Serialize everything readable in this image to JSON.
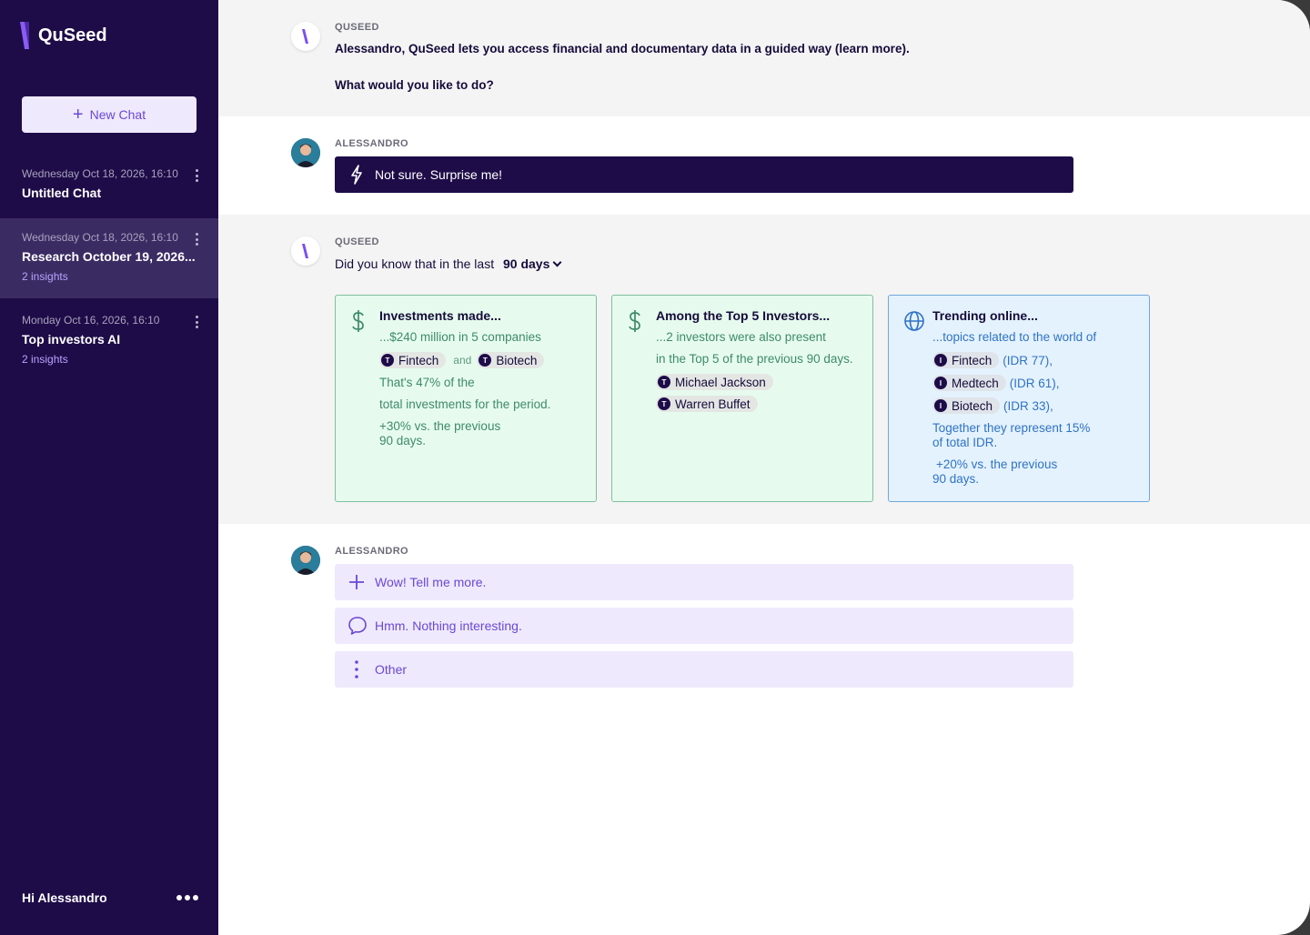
{
  "sidebar": {
    "brand": "QuSeed",
    "new_chat_label": "New Chat",
    "chats": [
      {
        "date": "Wednesday Oct 18, 2026, 16:10",
        "title": "Untitled Chat",
        "insights": ""
      },
      {
        "date": "Wednesday Oct 18, 2026, 16:10",
        "title": "Research October 19, 2026...",
        "insights": "2 insights"
      },
      {
        "date": "Monday Oct 16, 2026, 16:10",
        "title": "Top investors AI",
        "insights": "2 insights"
      }
    ],
    "greeting": "Hi Alessandro"
  },
  "conversation": {
    "intro": {
      "sender": "QUSEED",
      "line1": "Alessandro, QuSeed lets you access financial and documentary data in a guided way (learn more).",
      "line2": "What would you like to do?"
    },
    "reply1": {
      "sender": "ALESSANDRO",
      "choice": "Not sure. Surprise me!"
    },
    "insight": {
      "sender": "QUSEED",
      "prompt": "Did you know that in the last",
      "period": "90 days",
      "cards": [
        {
          "icon": "dollar-icon",
          "title": "Investments made...",
          "line1": "...$240 million in 5 companies",
          "tag1": "Fintech",
          "and": "and",
          "tag2": "Biotech",
          "line2": "That's 47% of the",
          "line3": "total investments for the period.",
          "line4a": "+30% vs. the previous",
          "line4b": "90 days."
        },
        {
          "icon": "dollar-icon",
          "title": "Among the Top 5 Investors...",
          "line1": "...2 investors were also present",
          "line2": "in the Top 5 of the previous 90 days.",
          "tag1": "Michael Jackson",
          "tag2": "Warren Buffet"
        },
        {
          "icon": "globe-icon",
          "title": "Trending online...",
          "line1": "...topics related to the world of",
          "topics": [
            {
              "tag": "Fintech",
              "idr": "(IDR 77),"
            },
            {
              "tag": "Medtech",
              "idr": "(IDR 61),"
            },
            {
              "tag": "Biotech",
              "idr": "(IDR 33),"
            }
          ],
          "line2a": "Together they represent 15%",
          "line2b": "of total IDR.",
          "line3a": "+20% vs. the previous",
          "line3b": "90 days."
        }
      ]
    },
    "reply2": {
      "sender": "ALESSANDRO",
      "options": [
        "Wow! Tell me more.",
        "Hmm. Nothing interesting.",
        "Other"
      ]
    }
  },
  "colors": {
    "sidebar_bg": "#1e0c48",
    "accent": "#6a48d4",
    "green_card": "#e6fbee",
    "blue_card": "#e4f2fd"
  }
}
